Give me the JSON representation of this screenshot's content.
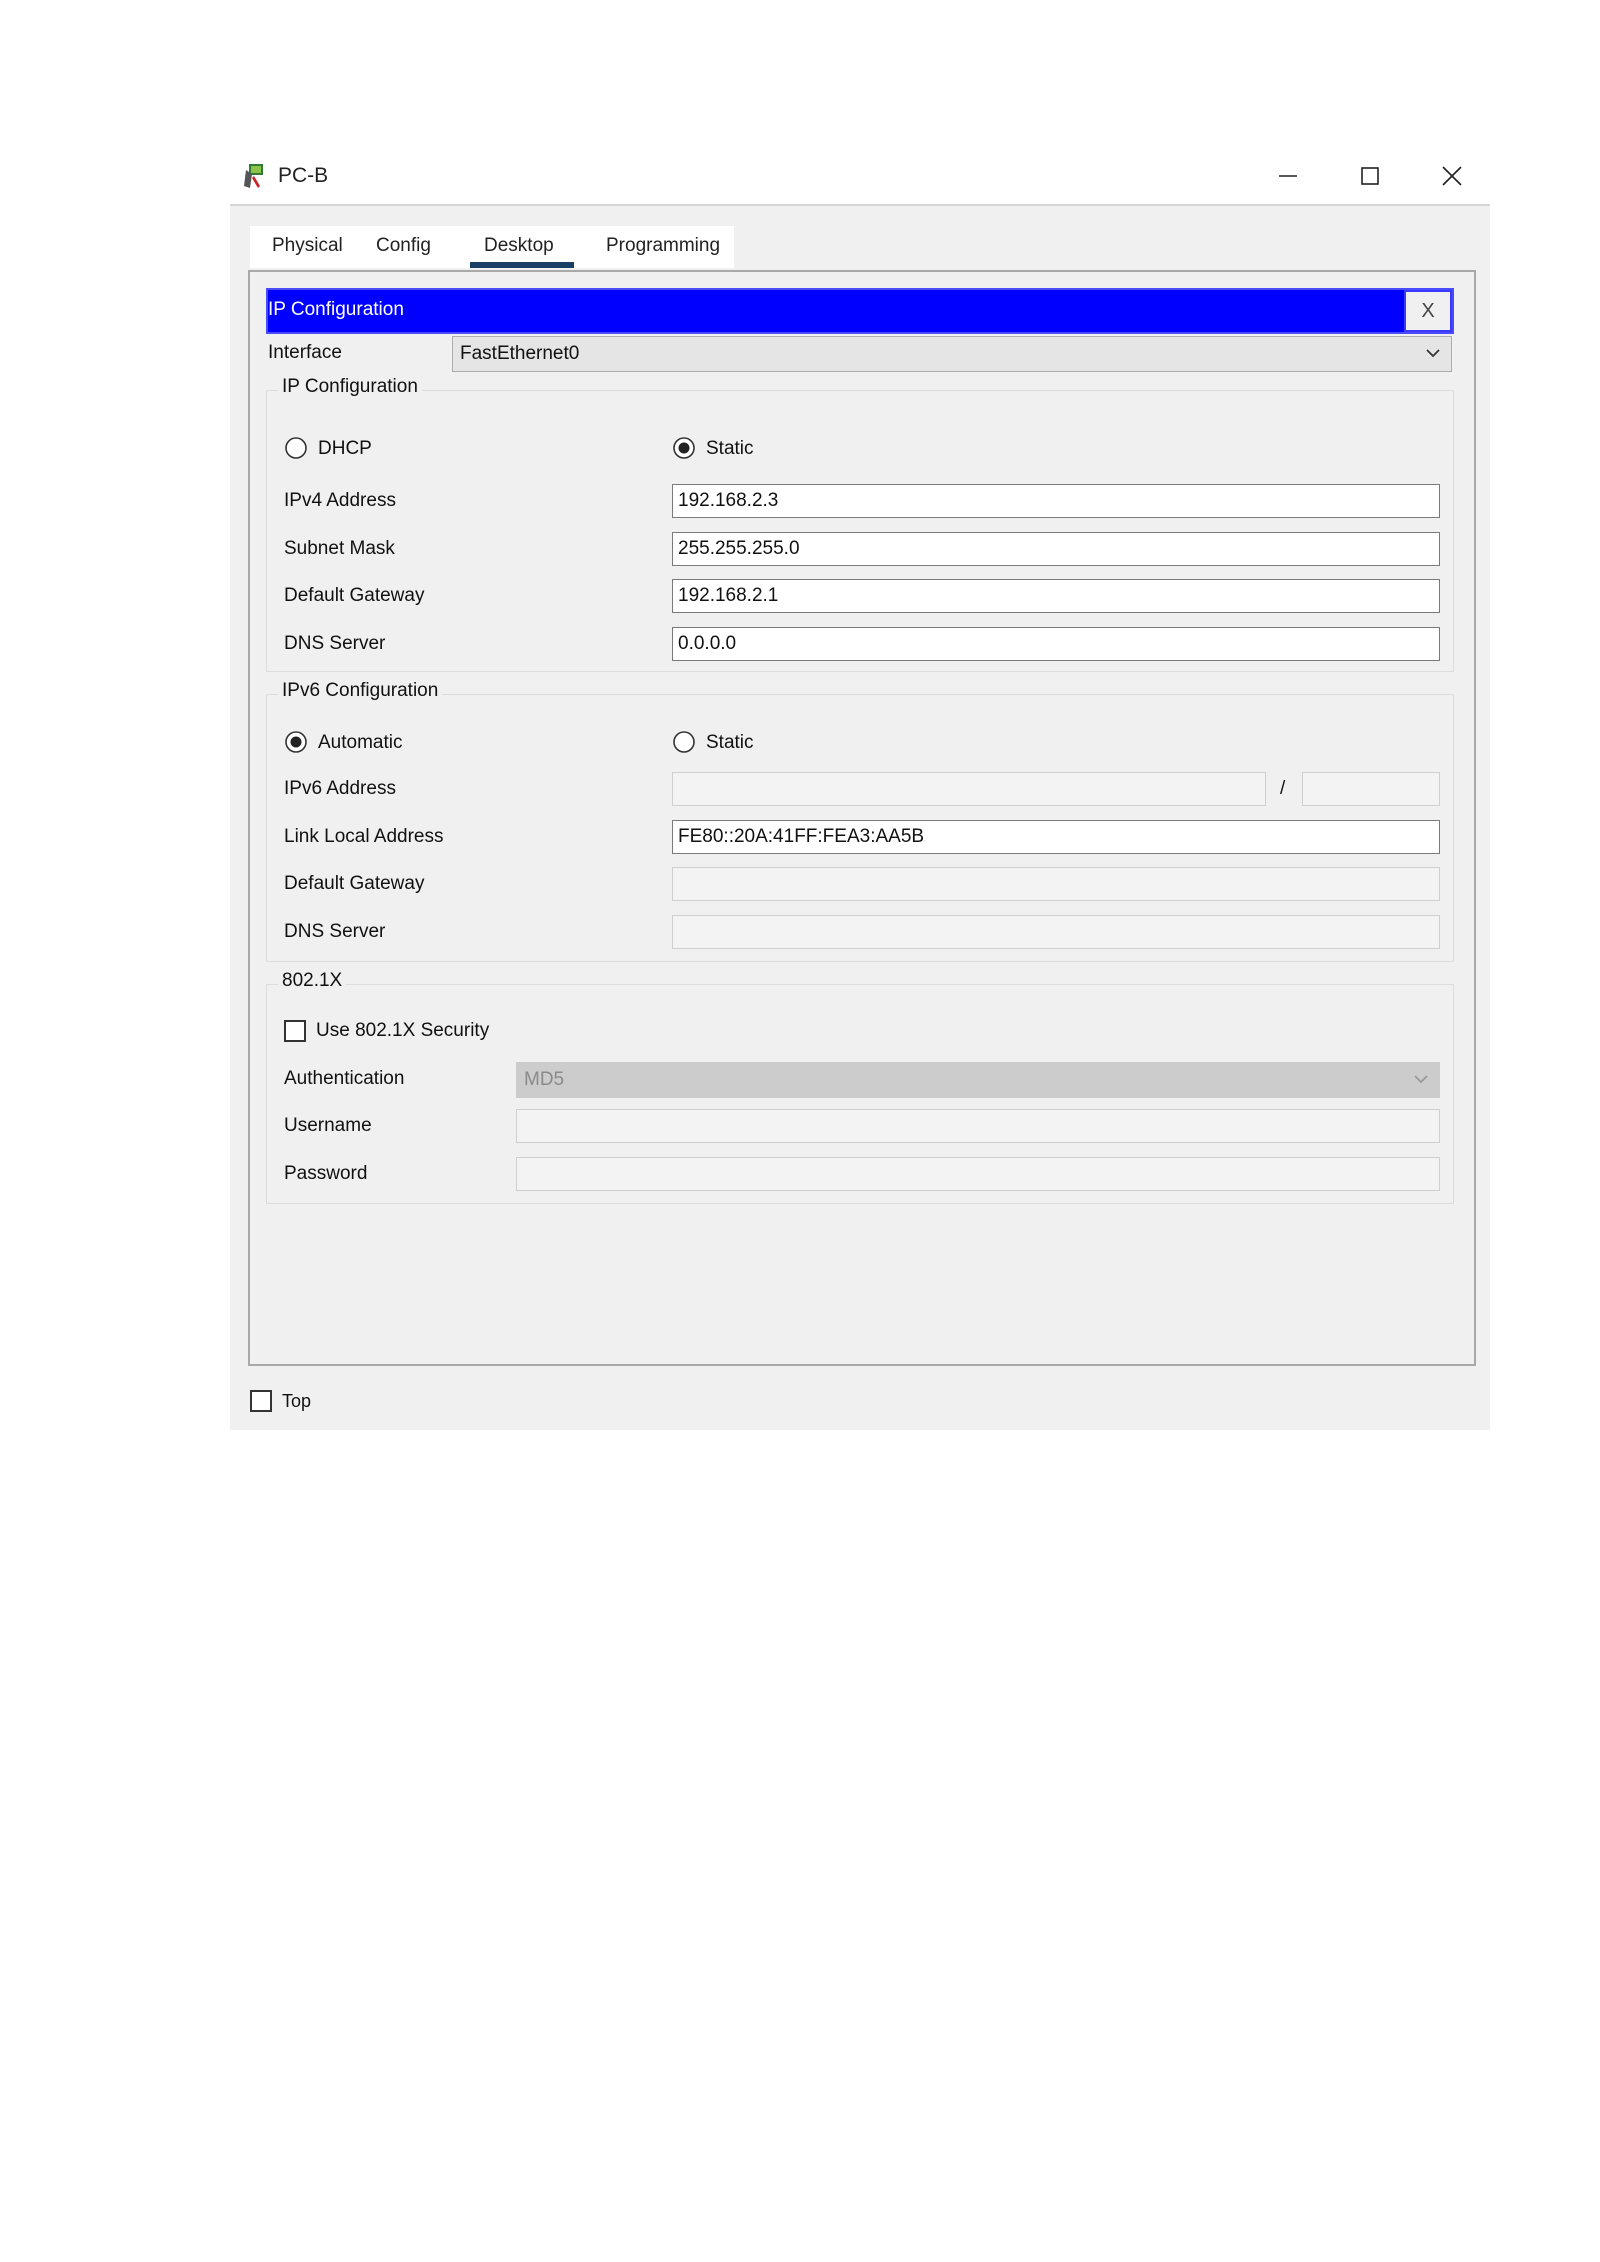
{
  "window": {
    "title": "PC-B",
    "icon": "pc-icon",
    "controls": {
      "minimize": "minimize-icon",
      "maximize": "maximize-icon",
      "close": "close-icon"
    }
  },
  "tabs": [
    {
      "label": "Physical",
      "active": false
    },
    {
      "label": "Config",
      "active": false
    },
    {
      "label": "Desktop",
      "active": true
    },
    {
      "label": "Programming",
      "active": false
    }
  ],
  "ip_config": {
    "header_title": "IP Configuration",
    "close_label": "X",
    "interface_label": "Interface",
    "interface_value": "FastEthernet0",
    "ipv4": {
      "legend": "IP Configuration",
      "dhcp_label": "DHCP",
      "static_label": "Static",
      "selected": "Static",
      "fields": [
        {
          "label": "IPv4 Address",
          "value": "192.168.2.3"
        },
        {
          "label": "Subnet Mask",
          "value": "255.255.255.0"
        },
        {
          "label": "Default Gateway",
          "value": "192.168.2.1"
        },
        {
          "label": "DNS Server",
          "value": "0.0.0.0"
        }
      ]
    },
    "ipv6": {
      "legend": "IPv6 Configuration",
      "automatic_label": "Automatic",
      "static_label": "Static",
      "selected": "Automatic",
      "address_label": "IPv6 Address",
      "address_value": "",
      "prefix_separator": "/",
      "prefix_value": "",
      "link_local_label": "Link Local Address",
      "link_local_value": "FE80::20A:41FF:FEA3:AA5B",
      "gateway_label": "Default Gateway",
      "gateway_value": "",
      "dns_label": "DNS Server",
      "dns_value": ""
    },
    "dot1x": {
      "legend": "802.1X",
      "use_security_label": "Use 802.1X Security",
      "use_security_checked": false,
      "auth_label": "Authentication",
      "auth_value": "MD5",
      "username_label": "Username",
      "username_value": "",
      "password_label": "Password",
      "password_value": ""
    }
  },
  "top_checkbox": {
    "label": "Top",
    "checked": false
  },
  "colors": {
    "header_blue": "#0000ff",
    "tab_underline": "#1a3f66",
    "window_bg": "#f0f0f0"
  }
}
